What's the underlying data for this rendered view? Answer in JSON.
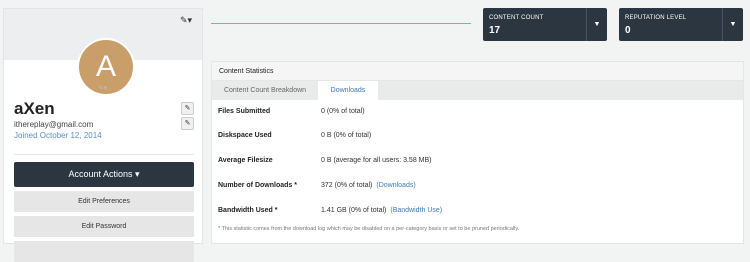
{
  "profile": {
    "avatar_letter": "A",
    "name": "aXen",
    "email": "ithereplay@gmail.com",
    "joined": "Joined October 12, 2014",
    "account_actions_label": "Account Actions ▾",
    "edit_preferences_label": "Edit Preferences",
    "edit_password_label": "Edit Password"
  },
  "stats": {
    "content_count_label": "CONTENT COUNT",
    "content_count_value": "17",
    "reputation_label": "REPUTATION LEVEL",
    "reputation_value": "0"
  },
  "panel": {
    "title": "Content Statistics",
    "tabs": [
      "Content Count Breakdown",
      "Downloads"
    ],
    "active_tab": "Downloads",
    "rows": [
      {
        "label": "Files Submitted",
        "value": "0 (0% of total)",
        "link": ""
      },
      {
        "label": "Diskspace Used",
        "value": "0 B (0% of total)",
        "link": ""
      },
      {
        "label": "Average Filesize",
        "value": "0 B (average for all users: 3.58 MB)",
        "link": ""
      },
      {
        "label": "Number of Downloads *",
        "value": "372 (0% of total)",
        "link": "(Downloads)"
      },
      {
        "label": "Bandwidth Used *",
        "value": "1.41 GB (0% of total)",
        "link": "(Bandwidth Use)"
      }
    ],
    "footnote": "* This statistic comes from the download log which may be disabled on a per-category basis or set to be pruned periodically."
  },
  "colors": {
    "dark": "#2b3640",
    "accent_green": "#62c3a0",
    "link_blue": "#3c7ab8",
    "avatar": "#c99e69"
  },
  "icons": [
    "pencil-icon",
    "caret-down-icon"
  ]
}
